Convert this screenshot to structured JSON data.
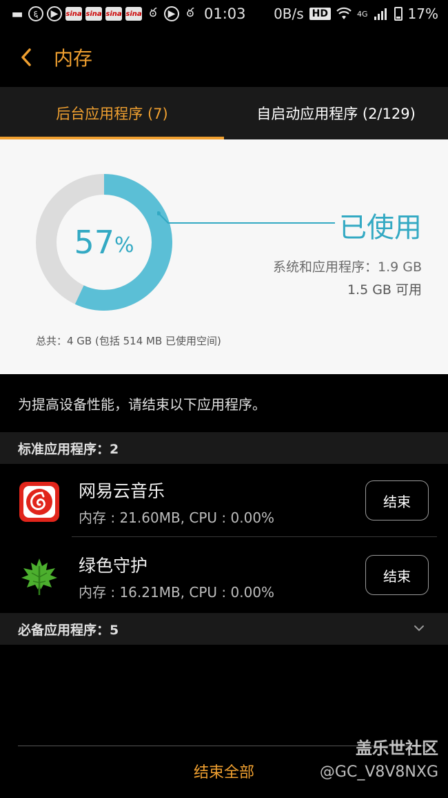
{
  "status_bar": {
    "time": "01:03",
    "net_speed": "0B/s",
    "hd_badge": "HD",
    "network": "4G",
    "battery": "17%",
    "left_icons": [
      "chat-bubble-icon",
      "netease-icon",
      "play-icon",
      "sina-icon",
      "sina-icon",
      "sina-icon",
      "sina-icon",
      "uc-squirrel-icon",
      "play-icon",
      "uc-squirrel-icon"
    ],
    "sina_text": "sina"
  },
  "header": {
    "title": "内存"
  },
  "tabs": [
    {
      "label": "后台应用程序 (7)",
      "active": true
    },
    {
      "label": "自启动应用程序 (2/129)",
      "active": false
    }
  ],
  "memory": {
    "percent_value": 57,
    "percent_number": "57",
    "percent_symbol": "%",
    "used_label": "已使用",
    "system_apps_line": "系统和应用程序：1.9 GB",
    "available_line": "1.5 GB 可用",
    "total_line": "总共：4 GB (包括 514 MB 已使用空间)",
    "colors": {
      "used": "#5bbfd6",
      "free": "#dcdcdc",
      "text": "#33a9c3"
    }
  },
  "notice": "为提高设备性能，请结束以下应用程序。",
  "standard_section": {
    "title": "标准应用程序：2"
  },
  "apps": [
    {
      "name": "网易云音乐",
      "meta": "内存 : 21.60MB, CPU : 0.00%",
      "button": "结束",
      "icon": "netease-music-icon"
    },
    {
      "name": "绿色守护",
      "meta": "内存 : 16.21MB, CPU : 0.00%",
      "button": "结束",
      "icon": "green-maple-leaf-icon"
    }
  ],
  "required_section": {
    "title": "必备应用程序：5"
  },
  "end_all_label": "结束全部",
  "watermark": {
    "line1": "盖乐世社区",
    "line2": "@GC_V8V8NXG"
  },
  "accent_color": "#f0a030"
}
